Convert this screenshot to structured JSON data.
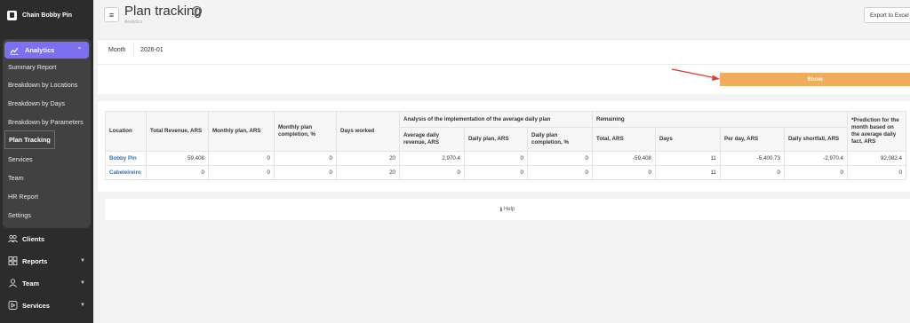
{
  "brand": {
    "name": "Chain Bobby Pin"
  },
  "sidebar": {
    "analytics_label": "Analytics",
    "sub_items": [
      "Summary Report",
      "Breakdown by Locations",
      "Breakdown by Days",
      "Breakdown by Parameters",
      "Plan Tracking",
      "Services",
      "Team",
      "HR Report",
      "Settings"
    ],
    "active_index": 4,
    "main_items": [
      "Clients",
      "Reports",
      "Team",
      "Services"
    ]
  },
  "header": {
    "title": "Plan tracking",
    "breadcrumb": "Analytics",
    "export_label": "Export to Excel"
  },
  "filter": {
    "month_label": "Month",
    "month_value": "2026-01",
    "show_label": "Show"
  },
  "table": {
    "headers": {
      "location": "Location",
      "total_revenue": "Total Revenue, ARS",
      "monthly_plan": "Monthly plan, ARS",
      "monthly_completion": "Monthly plan completion, %",
      "days_worked": "Days worked",
      "analysis_group": "Analysis of the implementation of the average daily plan",
      "avg_daily_revenue": "Average daily revenue, ARS",
      "daily_plan": "Daily plan, ARS",
      "daily_completion": "Daily plan completion, %",
      "remaining_group": "Remaining",
      "total": "Total, ARS",
      "days": "Days",
      "per_day": "Per day, ARS",
      "daily_shortfall": "Daily shortfall, ARS",
      "prediction": "*Prediction for the month based on the average daily fact, ARS"
    },
    "rows": [
      {
        "location": "Bobby Pin",
        "total_revenue": "59,408",
        "monthly_plan": "0",
        "monthly_completion": "0",
        "days_worked": "20",
        "avg_daily_revenue": "2,970.4",
        "daily_plan": "0",
        "daily_completion": "0",
        "total": "-59,408",
        "days": "11",
        "per_day": "-5,400.73",
        "daily_shortfall": "-2,970.4",
        "prediction": "92,082.4"
      },
      {
        "location": "Cabeleireiro",
        "total_revenue": "0",
        "monthly_plan": "0",
        "monthly_completion": "0",
        "days_worked": "20",
        "avg_daily_revenue": "0",
        "daily_plan": "0",
        "daily_completion": "0",
        "total": "0",
        "days": "11",
        "per_day": "0",
        "daily_shortfall": "0",
        "prediction": "0"
      }
    ]
  },
  "help": {
    "label": "Help"
  },
  "colors": {
    "accent": "#7b6ff2",
    "show_button": "#f0ad5e",
    "highlight": "#e0402f",
    "link": "#2f6fb5"
  }
}
